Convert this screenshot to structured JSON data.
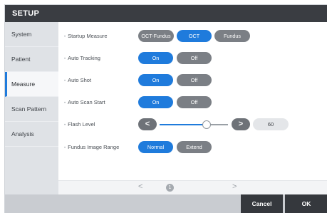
{
  "title": "SETUP",
  "sidebar": {
    "items": [
      {
        "label": "System"
      },
      {
        "label": "Patient"
      },
      {
        "label": "Measure"
      },
      {
        "label": "Scan Pattern"
      },
      {
        "label": "Analysis"
      }
    ],
    "active": "Measure"
  },
  "settings": {
    "startup_measure": {
      "label": "Startup Measure",
      "options": [
        "OCT-Fundus",
        "OCT",
        "Fundus"
      ],
      "selected": "OCT"
    },
    "auto_tracking": {
      "label": "Auto Tracking",
      "on_label": "On",
      "off_label": "Off",
      "selected": "On"
    },
    "auto_shot": {
      "label": "Auto Shot",
      "on_label": "On",
      "off_label": "Off",
      "selected": "On"
    },
    "auto_scan_start": {
      "label": "Auto Scan Start",
      "on_label": "On",
      "off_label": "Off",
      "selected": "On"
    },
    "flash_level": {
      "label": "Flash Level",
      "value": "60",
      "decrease": "<",
      "increase": ">"
    },
    "fundus_image_range": {
      "label": "Fundus Image Range",
      "options": [
        "Normal",
        "Extend"
      ],
      "selected": "Normal"
    }
  },
  "pager": {
    "prev": "<",
    "page": "1",
    "next": ">"
  },
  "footer": {
    "cancel_label": "Cancel",
    "ok_label": "OK"
  },
  "colors": {
    "accent": "#1f7bdc",
    "inactive": "#7b7f85",
    "titlebar": "#3a3d42",
    "footer_button": "#35383d"
  }
}
